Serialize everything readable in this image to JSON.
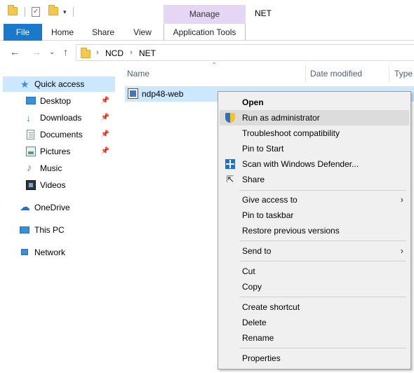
{
  "quick_access_toolbar": {
    "icons": [
      "folder-icon",
      "properties-icon",
      "new-folder-icon",
      "customize-dropdown-icon"
    ]
  },
  "contextual_tab": {
    "group_label": "Manage",
    "tab_label": "Application Tools",
    "color": "#e6d6f5"
  },
  "window": {
    "title": "NET"
  },
  "ribbon": {
    "tabs": [
      "File",
      "Home",
      "Share",
      "View"
    ],
    "file_tab_color": "#1979ca"
  },
  "address": {
    "breadcrumbs": [
      "NCD",
      "NET"
    ]
  },
  "nav_pane": {
    "items": [
      {
        "label": "Quick access",
        "icon": "star-icon",
        "selected": true
      },
      {
        "label": "Desktop",
        "icon": "desktop-icon",
        "pinned": true
      },
      {
        "label": "Downloads",
        "icon": "downloads-icon",
        "pinned": true
      },
      {
        "label": "Documents",
        "icon": "documents-icon",
        "pinned": true
      },
      {
        "label": "Pictures",
        "icon": "pictures-icon",
        "pinned": true
      },
      {
        "label": "Music",
        "icon": "music-icon"
      },
      {
        "label": "Videos",
        "icon": "videos-icon"
      },
      {
        "label": "OneDrive",
        "icon": "onedrive-icon"
      },
      {
        "label": "This PC",
        "icon": "this-pc-icon"
      },
      {
        "label": "Network",
        "icon": "network-icon"
      }
    ]
  },
  "file_list": {
    "columns": [
      "Name",
      "Date modified",
      "Type"
    ],
    "files": [
      {
        "name": "ndp48-web",
        "icon": "installer-icon",
        "selected": true
      }
    ]
  },
  "context_menu": {
    "items": [
      {
        "label": "Open",
        "bold": true
      },
      {
        "label": "Run as administrator",
        "icon": "uac-shield-icon",
        "highlighted": true
      },
      {
        "label": "Troubleshoot compatibility"
      },
      {
        "label": "Pin to Start"
      },
      {
        "label": "Scan with Windows Defender...",
        "icon": "defender-icon"
      },
      {
        "label": "Share",
        "icon": "share-icon"
      },
      {
        "label": "Give access to",
        "submenu": true
      },
      {
        "label": "Pin to taskbar"
      },
      {
        "label": "Restore previous versions"
      },
      {
        "label": "Send to",
        "submenu": true
      },
      {
        "label": "Cut"
      },
      {
        "label": "Copy"
      },
      {
        "label": "Create shortcut"
      },
      {
        "label": "Delete"
      },
      {
        "label": "Rename"
      },
      {
        "label": "Properties"
      }
    ]
  }
}
